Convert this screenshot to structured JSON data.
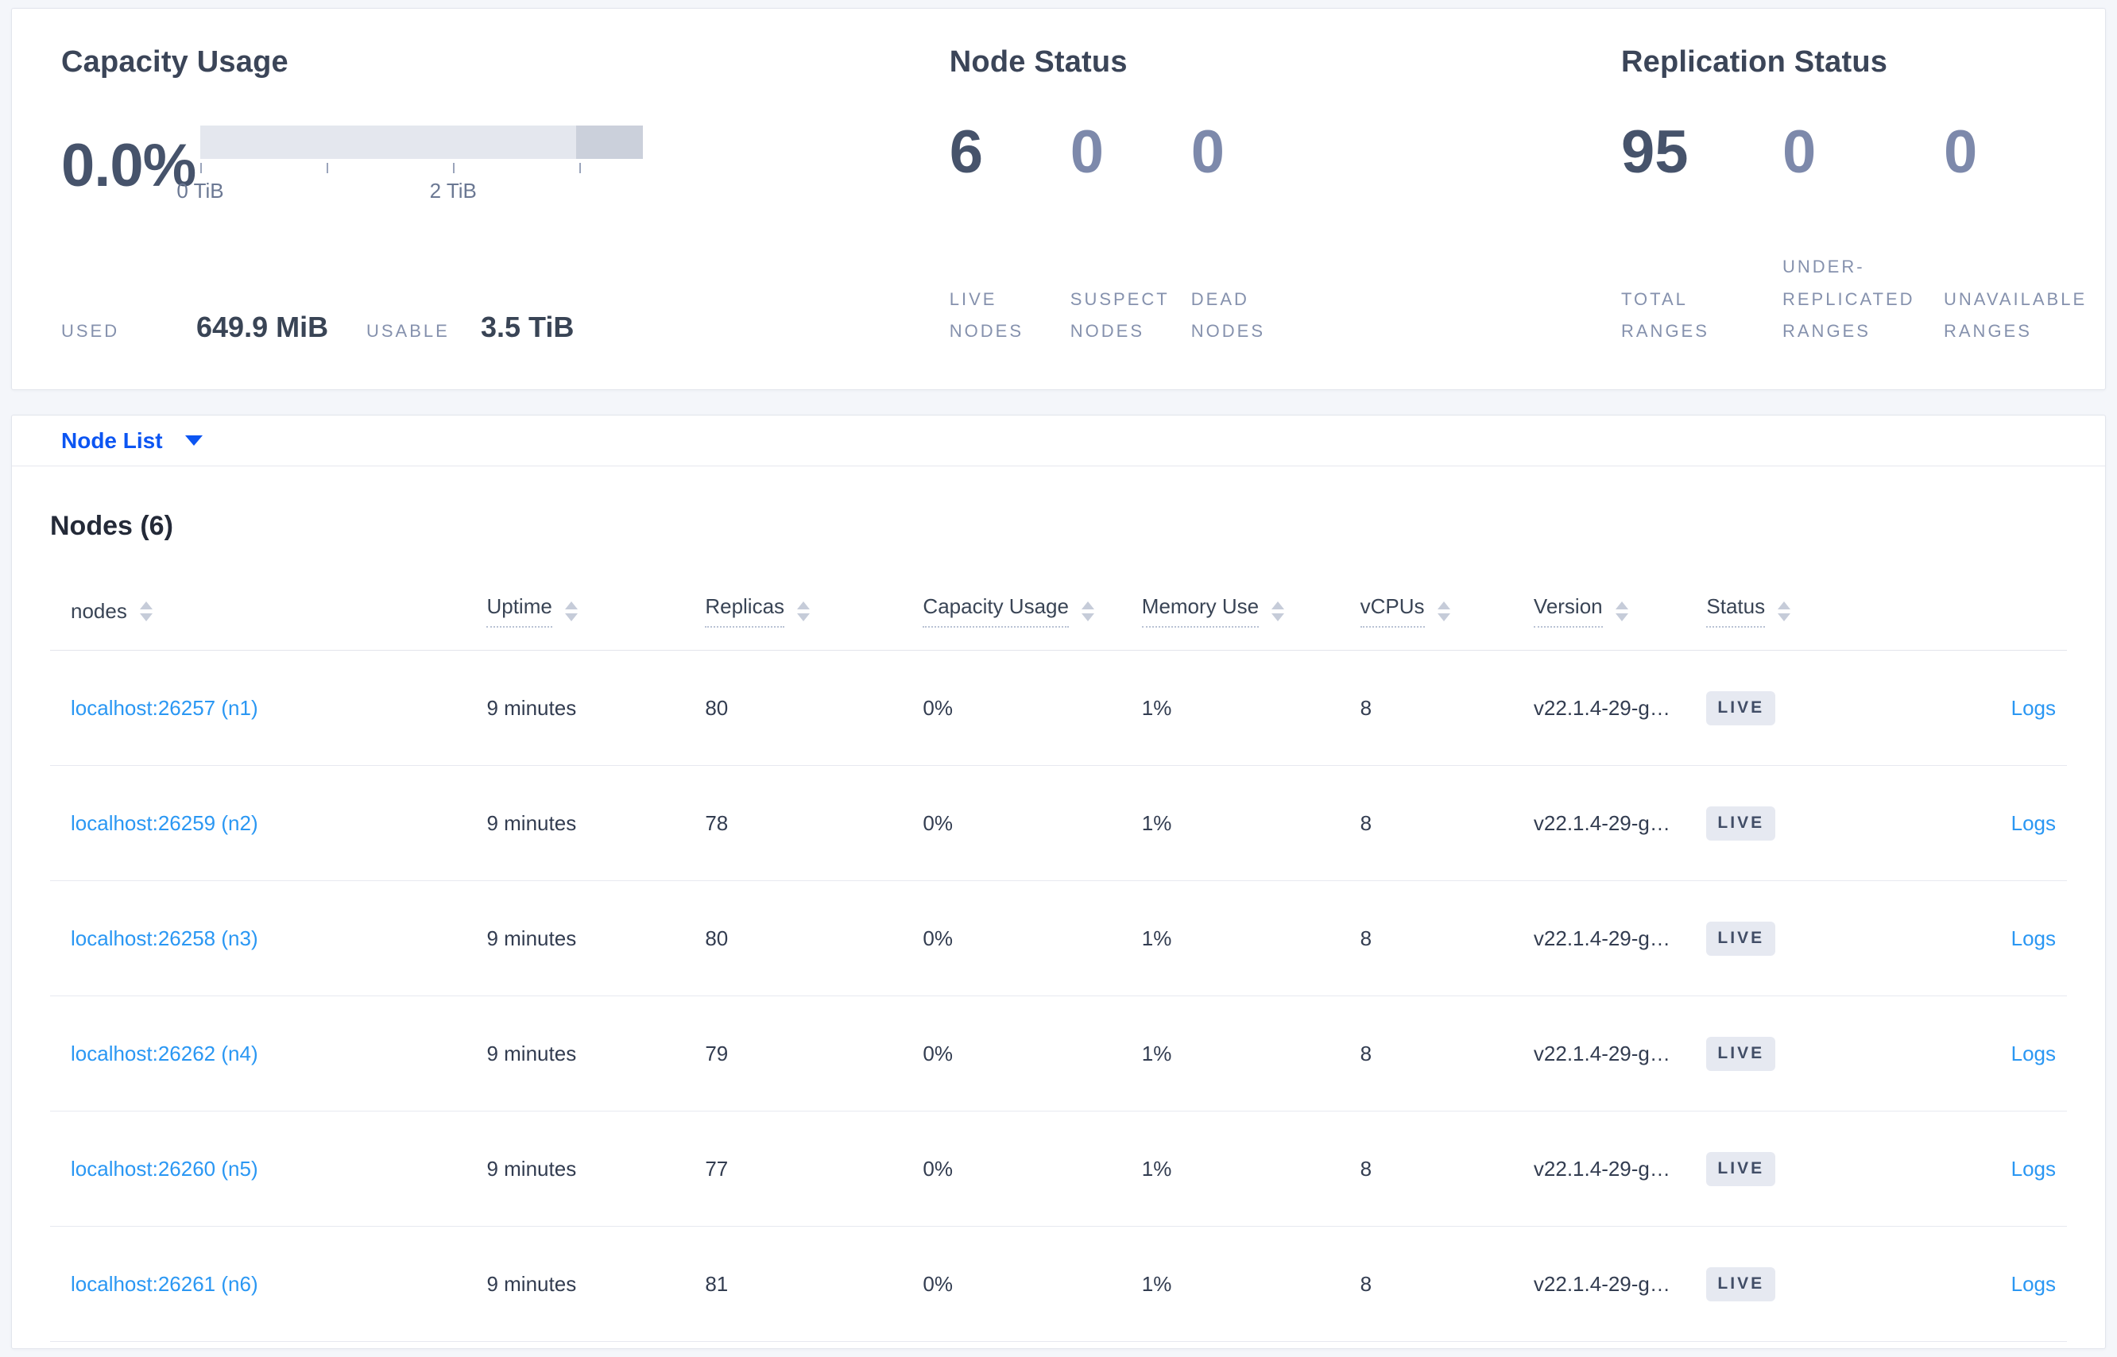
{
  "colors": {
    "page_background": "#f4f6fa",
    "panel_background": "#ffffff",
    "selector_blue": "#0c55f2",
    "link_blue": "#2a97f3",
    "heading_slate": "#3b4558",
    "muted_number": "#7d89ab",
    "emphasis_number": "#46536b",
    "bar_track": "#e4e7ee",
    "bar_overflow_segment": "#cbd0db",
    "badge_background": "#e6e9f1"
  },
  "summary": {
    "capacity": {
      "title": "Capacity Usage",
      "percent": "0.0%",
      "used_label": "USED",
      "used_value": "649.9 MiB",
      "usable_label": "USABLE",
      "usable_value": "3.5 TiB",
      "axis": {
        "tick_positions_pct": [
          0,
          28.57,
          57.14,
          85.71
        ],
        "labeled_ticks": [
          {
            "label": "0 TiB",
            "position_pct": 0
          },
          {
            "label": "2 TiB",
            "position_pct": 57.14
          }
        ],
        "used_fraction_pct": 0,
        "overflow_segment_start_pct": 85
      }
    },
    "node_status": {
      "title": "Node Status",
      "metrics": [
        {
          "value": "6",
          "label": "LIVE NODES"
        },
        {
          "value": "0",
          "label": "SUSPECT NODES"
        },
        {
          "value": "0",
          "label": "DEAD NODES"
        }
      ]
    },
    "replication": {
      "title": "Replication Status",
      "metrics": [
        {
          "value": "95",
          "label": "TOTAL RANGES"
        },
        {
          "value": "0",
          "label": "UNDER-REPLICATED RANGES"
        },
        {
          "value": "0",
          "label": "UNAVAILABLE RANGES"
        }
      ]
    }
  },
  "view_selector": {
    "label": "Node List"
  },
  "table": {
    "title": "Nodes (6)",
    "columns": [
      {
        "label": "nodes"
      },
      {
        "label": "Uptime"
      },
      {
        "label": "Replicas"
      },
      {
        "label": "Capacity Usage"
      },
      {
        "label": "Memory Use"
      },
      {
        "label": "vCPUs"
      },
      {
        "label": "Version"
      },
      {
        "label": "Status"
      }
    ],
    "rows": [
      {
        "node": "localhost:26257 (n1)",
        "uptime": "9 minutes",
        "replicas": "80",
        "capacity_usage": "0%",
        "memory_use": "1%",
        "vcpus": "8",
        "version": "v22.1.4-29-g…",
        "status": "LIVE",
        "logs": "Logs"
      },
      {
        "node": "localhost:26259 (n2)",
        "uptime": "9 minutes",
        "replicas": "78",
        "capacity_usage": "0%",
        "memory_use": "1%",
        "vcpus": "8",
        "version": "v22.1.4-29-g…",
        "status": "LIVE",
        "logs": "Logs"
      },
      {
        "node": "localhost:26258 (n3)",
        "uptime": "9 minutes",
        "replicas": "80",
        "capacity_usage": "0%",
        "memory_use": "1%",
        "vcpus": "8",
        "version": "v22.1.4-29-g…",
        "status": "LIVE",
        "logs": "Logs"
      },
      {
        "node": "localhost:26262 (n4)",
        "uptime": "9 minutes",
        "replicas": "79",
        "capacity_usage": "0%",
        "memory_use": "1%",
        "vcpus": "8",
        "version": "v22.1.4-29-g…",
        "status": "LIVE",
        "logs": "Logs"
      },
      {
        "node": "localhost:26260 (n5)",
        "uptime": "9 minutes",
        "replicas": "77",
        "capacity_usage": "0%",
        "memory_use": "1%",
        "vcpus": "8",
        "version": "v22.1.4-29-g…",
        "status": "LIVE",
        "logs": "Logs"
      },
      {
        "node": "localhost:26261 (n6)",
        "uptime": "9 minutes",
        "replicas": "81",
        "capacity_usage": "0%",
        "memory_use": "1%",
        "vcpus": "8",
        "version": "v22.1.4-29-g…",
        "status": "LIVE",
        "logs": "Logs"
      }
    ]
  }
}
